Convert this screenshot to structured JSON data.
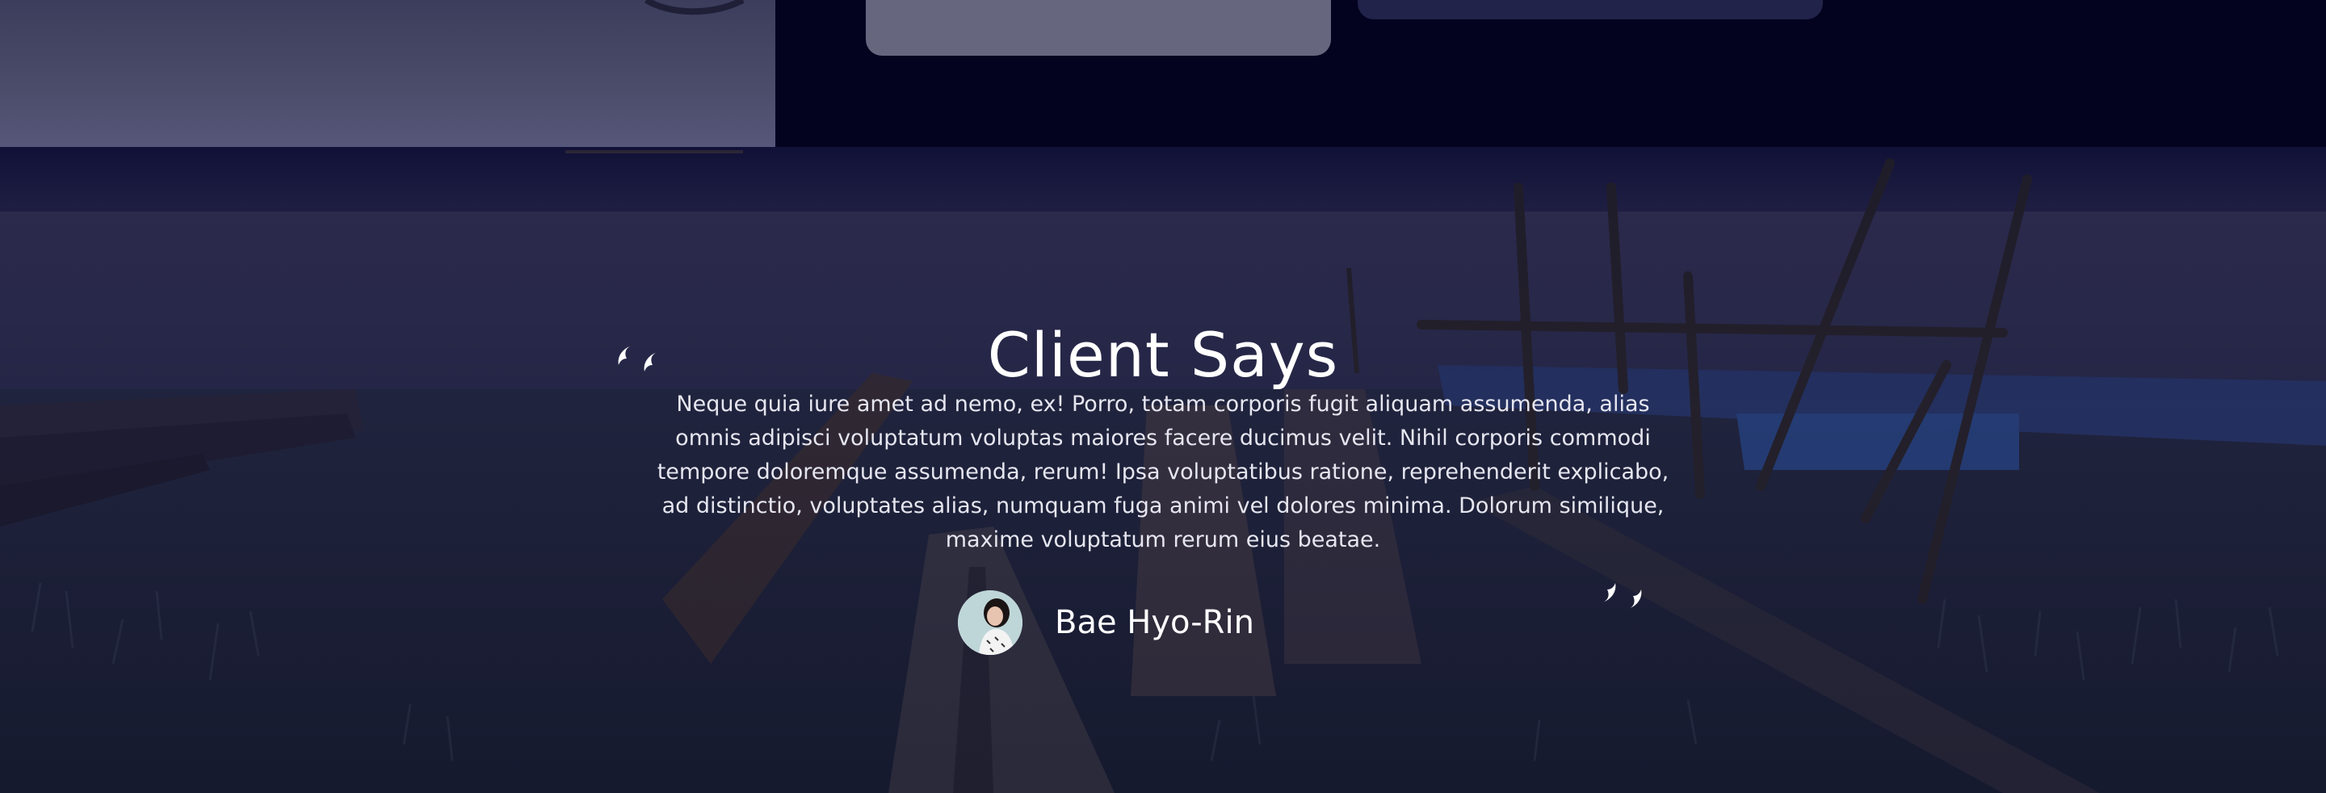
{
  "section": {
    "title": "Client Says",
    "quote": "Neque quia iure amet ad nemo, ex! Porro, totam corporis fugit aliquam assumenda, alias omnis adipisci voluptatum voluptas maiores facere ducimus velit. Nihil corporis commodi tempore doloremque assumenda, rerum! Ipsa voluptatibus ratione, reprehenderit explicabo, ad distinctio, voluptates alias, numquam fuga animi vel dolores minima. Dolorum similique, maxime voluptatum rerum eius beatae.",
    "author": "Bae Hyo-Rin",
    "open_quote_icon": "quote-open-icon",
    "close_quote_icon": "quote-close-icon"
  },
  "colors": {
    "page_bg": "#03031f",
    "card_light": "#66677e",
    "card_dark": "#22234a",
    "text": "#ffffff"
  }
}
